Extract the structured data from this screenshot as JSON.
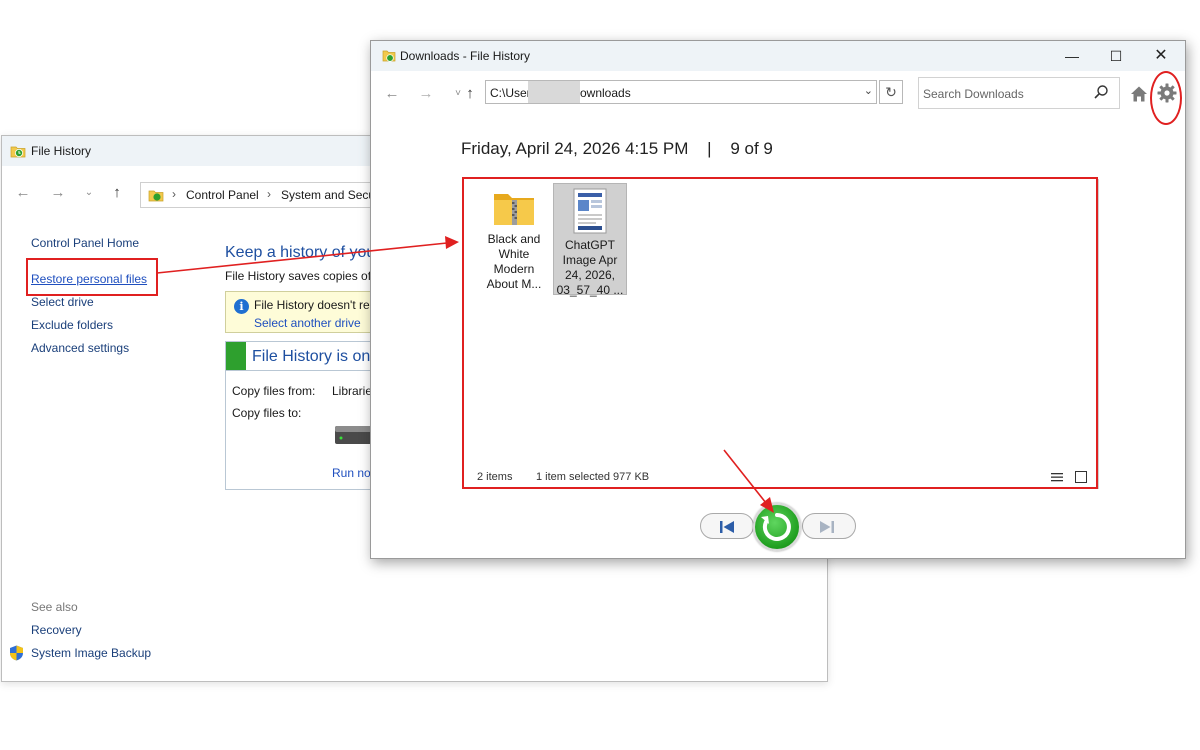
{
  "control_panel": {
    "title": "File History",
    "breadcrumb": [
      "Control Panel",
      "System and Secu"
    ],
    "sidebar": {
      "home": "Control Panel Home",
      "restore": "Restore personal files",
      "select_drive": "Select drive",
      "exclude": "Exclude folders",
      "advanced": "Advanced settings"
    },
    "heading": "Keep a history of you",
    "description": "File History saves copies of y",
    "info_text": "File History doesn't rec",
    "info_link": "Select another drive",
    "status_title": "File History is on",
    "copy_from_label": "Copy files from:",
    "copy_from_value": "Librarie",
    "copy_to_label": "Copy files to:",
    "run_link": "Run no",
    "see_also": "See also",
    "recovery": "Recovery",
    "system_image_backup": "System Image Backup"
  },
  "file_history": {
    "title": "Downloads - File History",
    "address_start": "C:\\User",
    "address_end": "ownloads",
    "search_placeholder": "Search Downloads",
    "snapshot_date": "Friday, April 24, 2026 4:15 PM",
    "snapshot_sep": "|",
    "snapshot_position": "9 of 9",
    "files": [
      {
        "name": "Black and White Modern About M...",
        "icon": "zip-folder-icon",
        "selected": false
      },
      {
        "name": "ChatGPT Image Apr 24, 2026, 03_57_40 ...",
        "icon": "image-thumbnail-icon",
        "selected": true
      }
    ],
    "status_items": "2 items",
    "status_selection": "1 item selected  977 KB"
  },
  "colors": {
    "annotation_red": "#e02020",
    "link_blue": "#1f4fbf",
    "heading_blue": "#1e4fa0",
    "restore_green": "#22a022"
  }
}
